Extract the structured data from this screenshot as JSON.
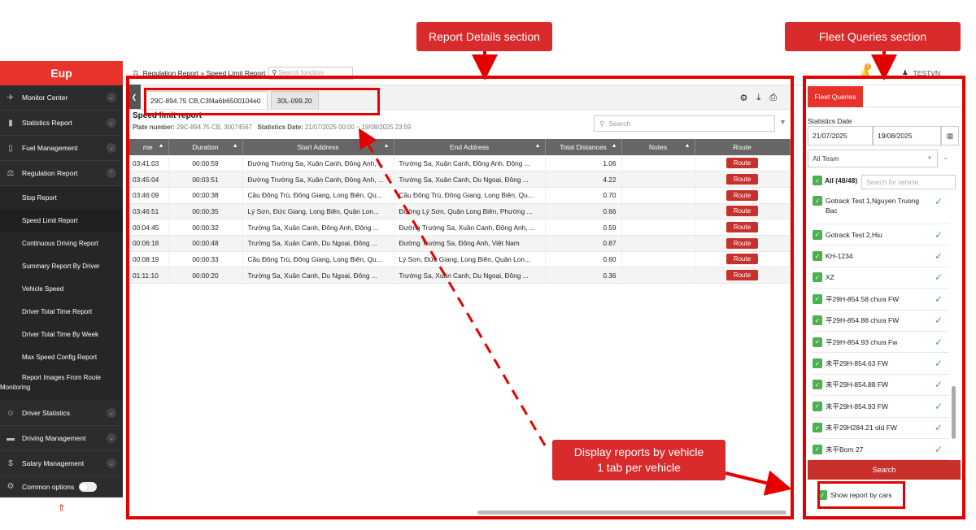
{
  "sidebar": {
    "logo": "Eup",
    "items": [
      {
        "label": "Monitor Center",
        "icon": "satellite-icon"
      },
      {
        "label": "Statistics Report",
        "icon": "chart-icon"
      },
      {
        "label": "Fuel Management",
        "icon": "fuel-icon"
      },
      {
        "label": "Regulation Report",
        "icon": "gavel-icon"
      }
    ],
    "sub_items": [
      "Stop Report",
      "Speed Limit Report",
      "Continuous Driving Report",
      "Summary Report By Driver",
      "Vehicle Speed",
      "Driver Total Time Report",
      "Driver Total Time By Week",
      "Max Speed Config Report",
      "Report Images From Route Monitoring"
    ],
    "items2": [
      {
        "label": "Driver Statistics",
        "icon": "driver-icon"
      },
      {
        "label": "Driving Management",
        "icon": "car-icon"
      },
      {
        "label": "Salary Management",
        "icon": "money-icon"
      }
    ],
    "common_options": "Common options",
    "back_top": "⇑"
  },
  "header": {
    "breadcrumb": "Regulation Report » Speed Limit Report",
    "search_placeholder": "Search function",
    "user": "TESTVN",
    "notif": "1"
  },
  "tabs": [
    "29C-894.75 CB,C3f4a6b6500104e0",
    "30L-099.20"
  ],
  "report": {
    "title": "Speed limit report",
    "plate_label": "Plate number:",
    "plate_value": "29C-894.75 CB, 30074567",
    "date_label": "Statistics Date:",
    "date_value": "21/07/2025 00:00 ~ 19/08/2025 23:59",
    "search_placeholder": "Search"
  },
  "table": {
    "headers": [
      "me",
      "Duration",
      "Start Address",
      "End Address",
      "Total Distances",
      "Notes",
      "Route"
    ],
    "route_label": "Route",
    "rows": [
      [
        "03:41:03",
        "00:00:59",
        "Đường Trường Sa, Xuân Canh, Đông Anh, ...",
        "Trường Sa, Xuân Canh, Đông Anh, Đông ...",
        "1.06",
        ""
      ],
      [
        "03:45:04",
        "00:03:51",
        "Đường Trường Sa, Xuân Canh, Đông Anh, ...",
        "Trường Sa, Xuân Canh, Du Ngoại, Đông ...",
        "4.22",
        ""
      ],
      [
        "03:46:09",
        "00:00:38",
        "Cầu Đông Trù, Đông Giang, Long Biên, Qu...",
        "Cầu Đông Trù, Đông Giang, Long Biên, Qu...",
        "0.70",
        ""
      ],
      [
        "03:46:51",
        "00:00:35",
        "Lý Sơn, Đức Giang, Long Biên, Quận Lon...",
        "Đường Lý Sơn, Quận Long Biên, Phường ...",
        "0.66",
        ""
      ],
      [
        "00:04:45",
        "00:00:32",
        "Trường Sa, Xuân Canh, Đông Anh, Đông ...",
        "Đường Trường Sa, Xuân Canh, Đông Anh, ...",
        "0.59",
        ""
      ],
      [
        "00:06:18",
        "00:00:48",
        "Trường Sa, Xuân Canh, Du Ngoại, Đông ...",
        "Đường Trường Sa, Đông Anh, Việt Nam",
        "0.87",
        ""
      ],
      [
        "00:08:19",
        "00:00:33",
        "Cầu Đông Trù, Đông Giang, Long Biên, Qu...",
        "Lý Sơn, Đức Giang, Long Biên, Quận Lon...",
        "0.60",
        ""
      ],
      [
        "01:11:10",
        "00:00:20",
        "Trường Sa, Xuân Canh, Du Ngoại, Đông ...",
        "Trường Sa, Xuân Canh, Du Ngoại, Đông ...",
        "0.36",
        ""
      ]
    ]
  },
  "fleet": {
    "tab": "Fleet Queries",
    "stat_label": "Statistics Date",
    "date_from": "21/07/2025",
    "date_to": "19/08/2025",
    "team": "All Team",
    "all_label": "All (48/48)",
    "vehicle_search_placeholder": "Search for vehicle",
    "vehicles": [
      "Gotrack Test 1,Nguyen Truong Bac",
      "Gotrack Test 2,Hiu",
      "KH-1234",
      "XZ",
      "平29H-854.58 chưa FW",
      "平29H-854.88 chưa FW",
      "平29H-854.93 chưa Fw",
      "未平29H-854.63 FW",
      "未平29H-854.88 FW",
      "未平29H-854.93 FW",
      "未平29H284.21 old FW",
      "未平Bom 27"
    ],
    "search_btn": "Search",
    "show_label": "Show report by cars"
  },
  "annotations": {
    "report_details": "Report Details section",
    "fleet_queries": "Fleet Queries section",
    "display_line1": "Display reports by vehicle",
    "display_line2": "1 tab per vehicle"
  },
  "colors": {
    "brand": "#e8332d",
    "annotation": "#e50000",
    "check": "#4caf50"
  }
}
